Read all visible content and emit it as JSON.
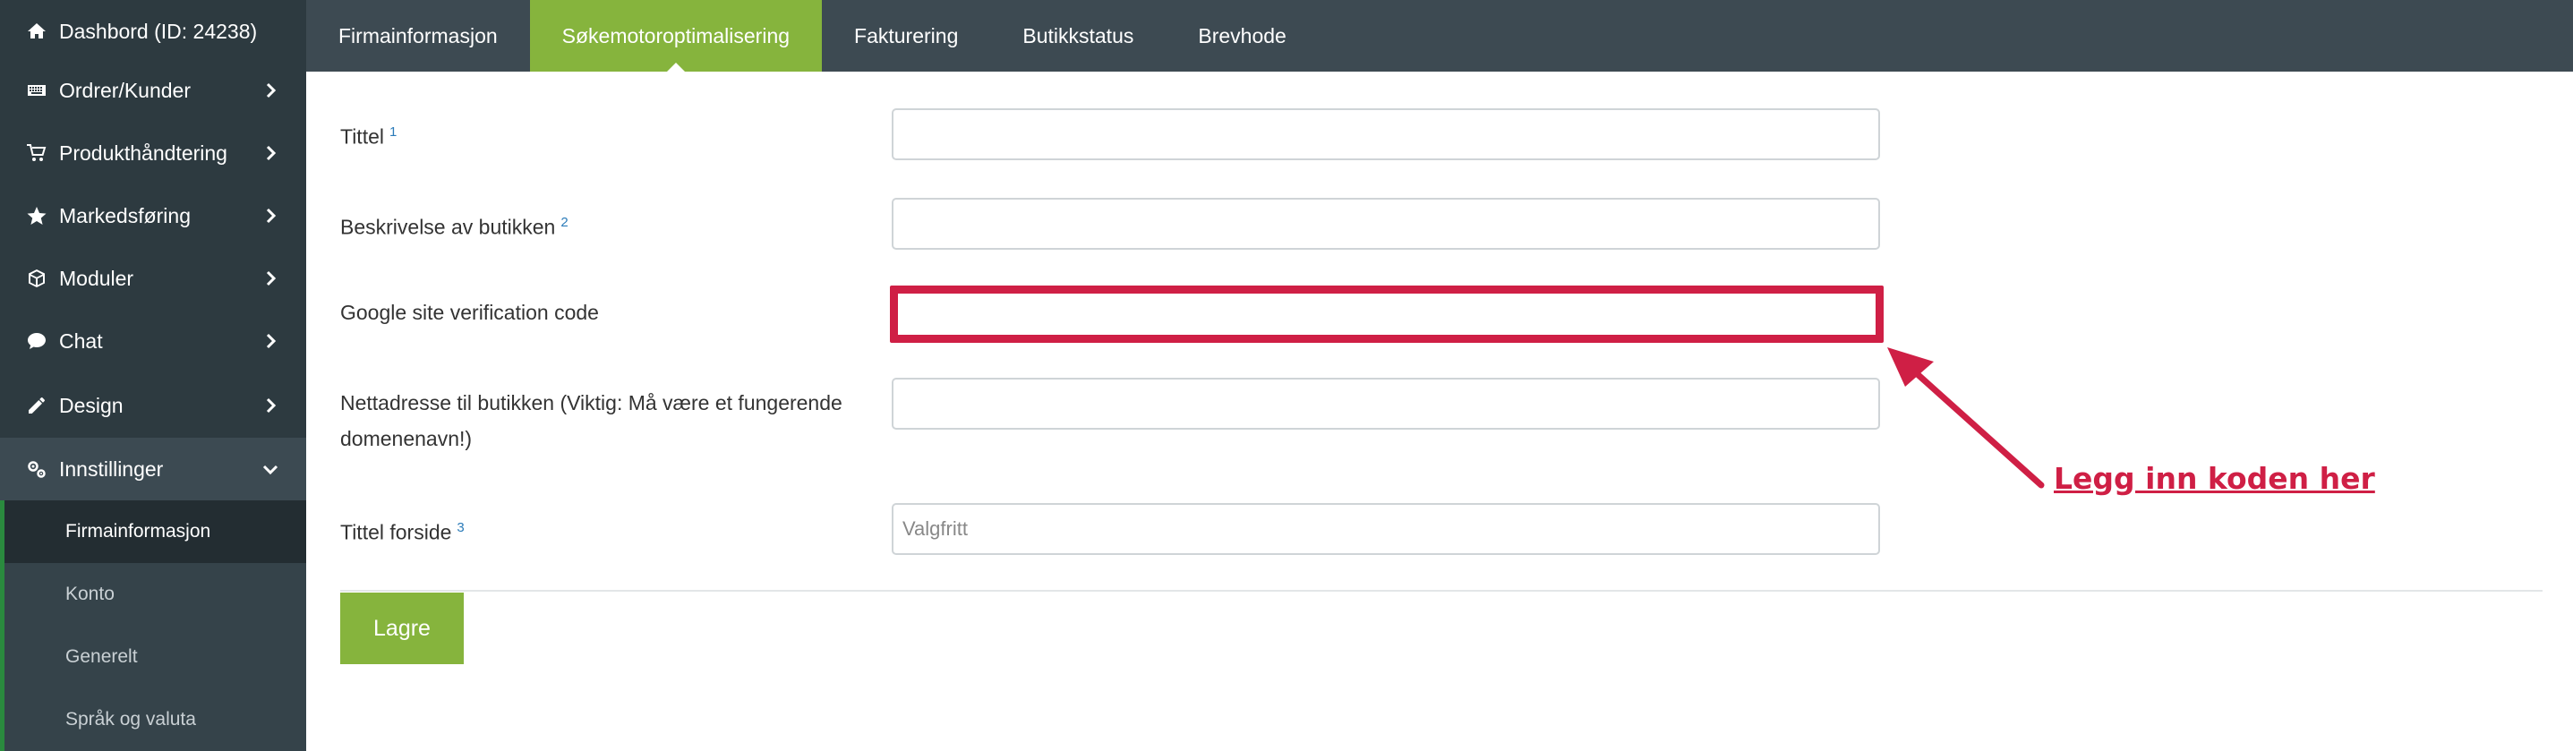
{
  "sidebar": {
    "items": [
      {
        "label": "Dashbord (ID: 24238)",
        "icon": "home-icon"
      },
      {
        "label": "Ordrer/Kunder",
        "icon": "keyboard-icon"
      },
      {
        "label": "Produkthåndtering",
        "icon": "cart-icon"
      },
      {
        "label": "Markedsføring",
        "icon": "star-icon"
      },
      {
        "label": "Moduler",
        "icon": "cube-icon"
      },
      {
        "label": "Chat",
        "icon": "chat-icon"
      },
      {
        "label": "Design",
        "icon": "pencil-icon"
      },
      {
        "label": "Innstillinger",
        "icon": "cogs-icon"
      }
    ],
    "sub_items": [
      {
        "label": "Firmainformasjon",
        "active": true
      },
      {
        "label": "Konto"
      },
      {
        "label": "Generelt"
      },
      {
        "label": "Språk og valuta"
      }
    ]
  },
  "tabs": [
    {
      "label": "Firmainformasjon"
    },
    {
      "label": "Søkemotoroptimalisering",
      "active": true
    },
    {
      "label": "Fakturering"
    },
    {
      "label": "Butikkstatus"
    },
    {
      "label": "Brevhode"
    }
  ],
  "form": {
    "title": {
      "label": "Tittel",
      "sup": "1",
      "value": ""
    },
    "description": {
      "label": "Beskrivelse av butikken",
      "sup": "2",
      "value": ""
    },
    "google_verification": {
      "label": "Google site verification code",
      "value": ""
    },
    "url": {
      "label_line1": "Nettadresse til butikken (Viktig: Må være et fungerende",
      "label_line2": "domenenavn!)",
      "value": ""
    },
    "front_title": {
      "label": "Tittel forside",
      "sup": "3",
      "placeholder": "Valgfritt",
      "value": ""
    },
    "save_label": "Lagre"
  },
  "annotation": {
    "text": "Legg inn koden her",
    "color": "#cf1f45"
  },
  "colors": {
    "sidebar": "#2d3a40",
    "tabbar": "#3d4a52",
    "accent": "#86b43d",
    "highlight": "#cf1f45"
  }
}
